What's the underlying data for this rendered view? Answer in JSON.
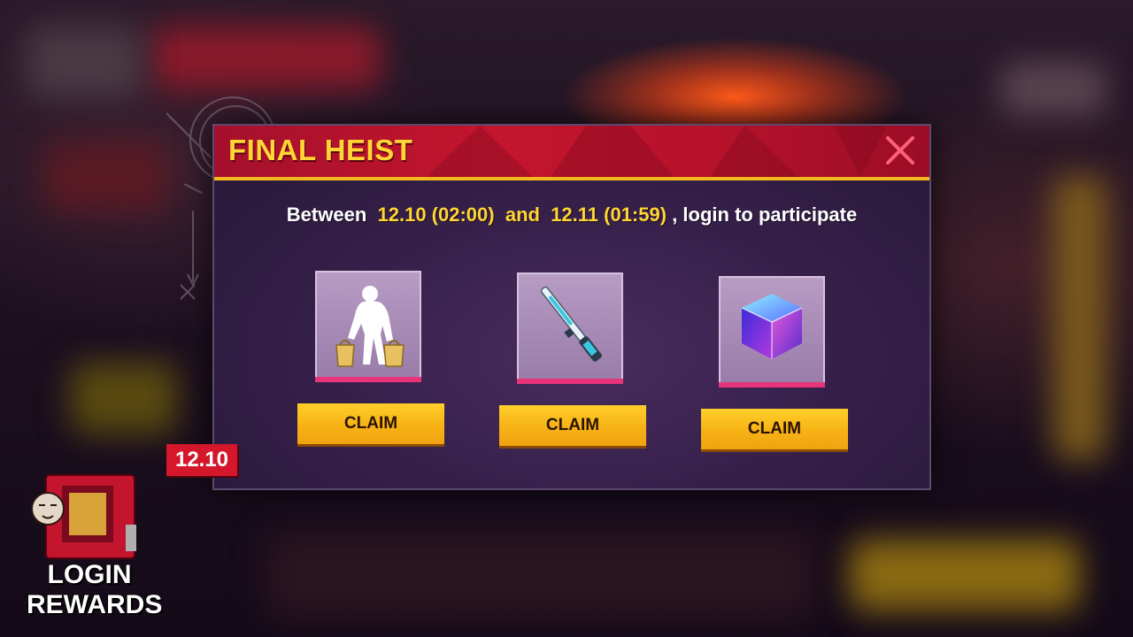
{
  "dialog": {
    "title": "FINAL HEIST",
    "subtitle": {
      "prefix": "Between",
      "start": "12.10 (02:00)",
      "connector": "and",
      "end": "12.11 (01:59)",
      "suffix": ", login to participate"
    },
    "close_icon": "close-x-icon"
  },
  "rewards": [
    {
      "icon": "heist-thief-emote-icon",
      "button_label": "CLAIM"
    },
    {
      "icon": "shotgun-skin-icon",
      "button_label": "CLAIM"
    },
    {
      "icon": "crystal-cube-icon",
      "button_label": "CLAIM"
    }
  ],
  "date_tag": "12.10",
  "login_widget": {
    "line1": "LOGIN",
    "line2": "REWARDS"
  },
  "colors": {
    "header_red": "#c4152e",
    "title_yellow": "#ffd633",
    "claim_yellow": "#f7b216",
    "tile_purple": "#a689b4",
    "accent_pink": "#e8347a"
  }
}
